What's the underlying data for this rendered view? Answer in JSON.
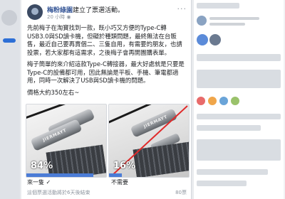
{
  "post": {
    "author": "梅粉綠園",
    "action": "建立了票選活動。",
    "time": "20 小時",
    "more_label": "···",
    "paragraphs": [
      "先前梅子在淘寶找到一款，既小巧又方便的Type-C轉USB3.0與SD讀卡機，但礙於種類問題，最終無法在台販售，最近自己要再賣個二、三隻自用，有需要的朋友，也請投票，若大家都有這需求，之後梅子會再開團購表單。",
      "梅子簡單的來介紹這款Type-C轉接器，最大好處就是只要是Type-C的設備都可用，因此無論是平板、手機、筆電都適用，同時一次解決了USB與SD讀卡機的問題。",
      "價格大約350左右~"
    ]
  },
  "poll": {
    "options": [
      {
        "label": "來一隻",
        "percent_text": "84%",
        "percent": 84,
        "brand": "JIERMAYT"
      },
      {
        "label": "不需要",
        "percent_text": "16%",
        "percent": 16,
        "brand": "JIERMAYT"
      }
    ],
    "footer_left": "這個票選活動將於6天後結束",
    "footer_right": "80票",
    "bar_color": "#4b7cd6"
  }
}
